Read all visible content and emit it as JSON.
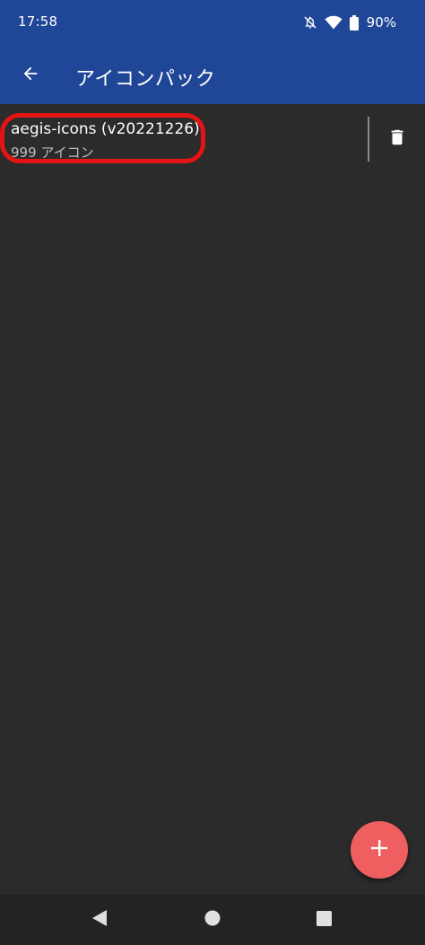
{
  "status_bar": {
    "time": "17:58",
    "battery_percent": "90%",
    "icons": [
      "notifications-off-icon",
      "wifi-icon",
      "battery-icon"
    ]
  },
  "app_bar": {
    "title": "アイコンパック",
    "back_icon": "arrow-back-icon"
  },
  "icon_packs": [
    {
      "title": "aegis-icons (v20221226)",
      "subtitle": "999 アイコン",
      "action_icon": "trash-icon"
    }
  ],
  "fab": {
    "icon": "plus-icon"
  },
  "nav_bar": {
    "icons": [
      "nav-back-icon",
      "nav-home-icon",
      "nav-recents-icon"
    ]
  },
  "colors": {
    "primary": "#1f4697",
    "background": "#2b2b2b",
    "fab": "#ef5f60",
    "highlight": "#e51414",
    "nav_bar": "#232323"
  }
}
